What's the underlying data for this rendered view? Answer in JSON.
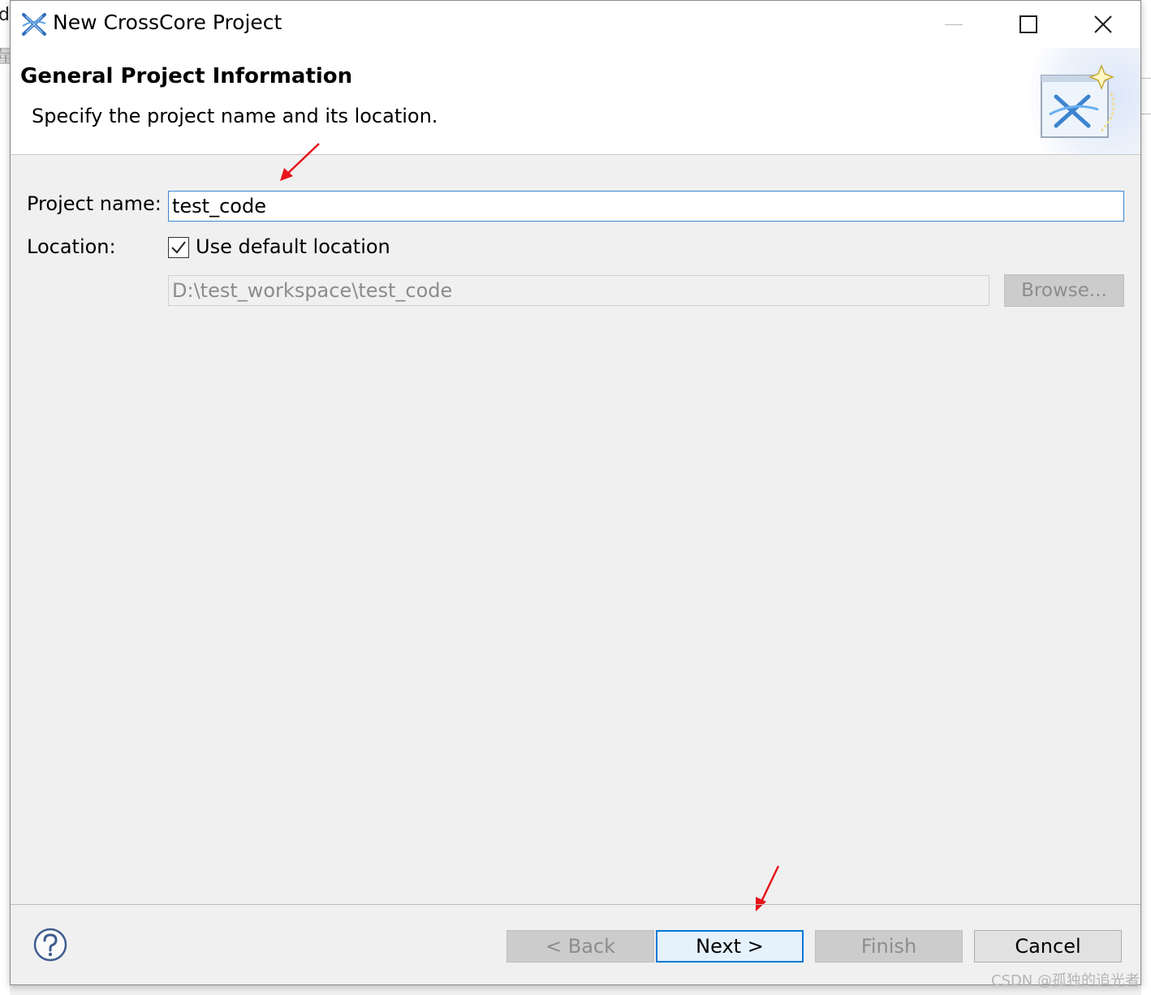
{
  "background": {
    "left_glyph": "d",
    "left_glyph2": "量"
  },
  "window": {
    "title": "New CrossCore Project",
    "icon": "crosscore-x-icon"
  },
  "header": {
    "title": "General Project Information",
    "description": "Specify the project name and its location.",
    "image": "crosscore-wizard-icon"
  },
  "form": {
    "project_name_label": "Project name:",
    "project_name_value": "test_code",
    "location_label": "Location:",
    "use_default_label": "Use default location",
    "use_default_checked": true,
    "location_value": "D:\\test_workspace\\test_code",
    "browse_label": "Browse..."
  },
  "footer": {
    "help_icon": "help-question-icon",
    "back_label": "< Back",
    "next_label": "Next >",
    "finish_label": "Finish",
    "cancel_label": "Cancel"
  },
  "watermark": "CSDN @孤独的追光者",
  "colors": {
    "accent": "#0078d7",
    "annotation_arrow": "#e8141b"
  }
}
